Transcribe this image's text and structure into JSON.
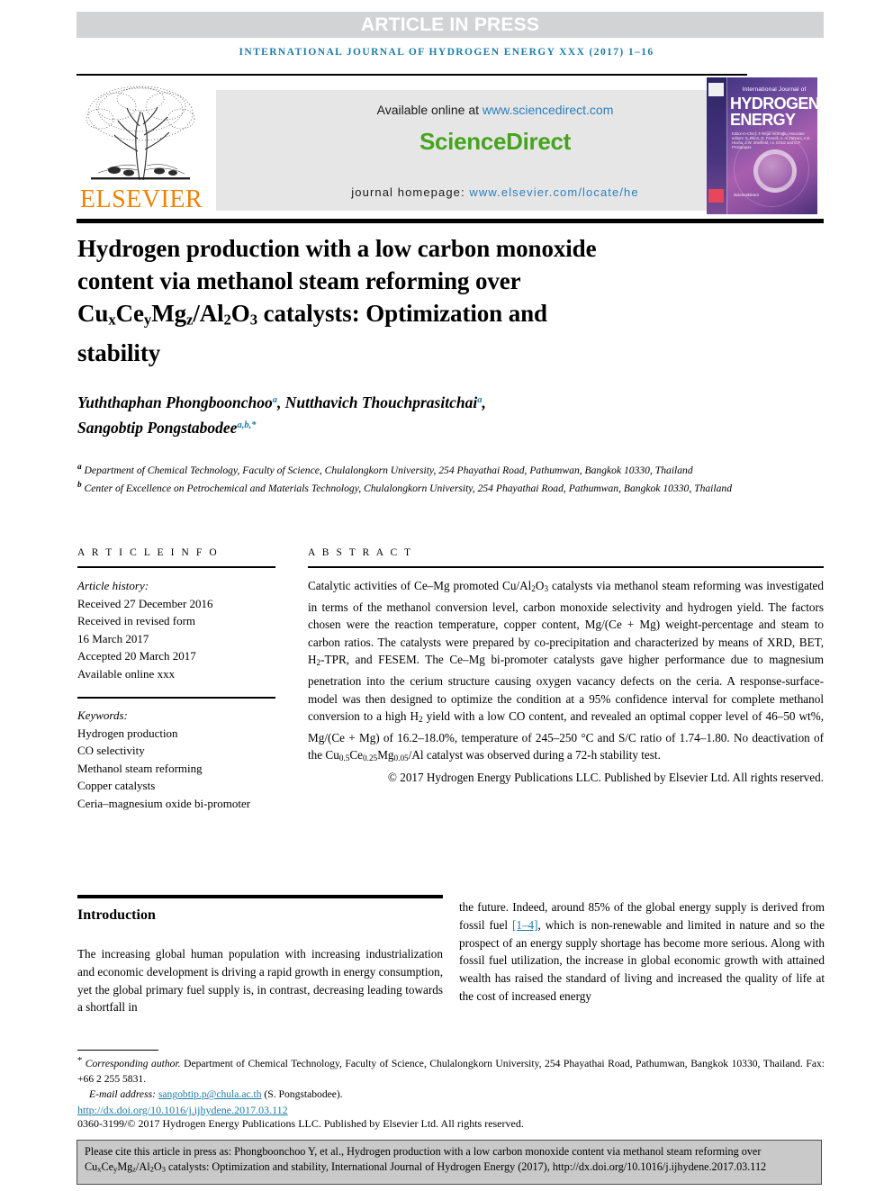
{
  "banner": {
    "article_in_press": "ARTICLE IN PRESS",
    "running_head": "INTERNATIONAL JOURNAL OF HYDROGEN ENERGY XXX (2017) 1–16"
  },
  "masthead": {
    "publisher_name": "ELSEVIER",
    "available_online_prefix": "Available online at ",
    "sciencedirect_url": "www.sciencedirect.com",
    "sciencedirect_logo": "ScienceDirect",
    "journal_homepage_prefix": "journal homepage: ",
    "journal_homepage_url": "www.elsevier.com/locate/he",
    "cover": {
      "line1": "International Journal of",
      "line2": "HYDROGEN",
      "line3": "ENERGY",
      "editors": "Editor-in-Chief: T. Nejat Veziroğlu   Associate editors: S. Dunn, D. Fennell, A. Al Zahrani, A.E. Hoxha, J.W. Sheffield, I.e. Ersoz and E.P. Protopapas",
      "sciencedirect_mark": "ScienceDirect"
    }
  },
  "article": {
    "title_line1": "Hydrogen production with a low carbon monoxide",
    "title_line2": "content via methanol steam reforming over",
    "title_line3_formula": "Cu",
    "title_line3_rest": " catalysts: Optimization and",
    "title_line4": "stability",
    "title_plain": "Hydrogen production with a low carbon monoxide content via methanol steam reforming over CuxCeyMgz/Al2O3 catalysts: Optimization and stability",
    "authors": [
      {
        "name": "Yuththaphan Phongboonchoo",
        "marks": "a"
      },
      {
        "name": "Nutthavich Thouchprasitchai",
        "marks": "a"
      },
      {
        "name": "Sangobtip Pongstabodee",
        "marks": "a,b,*"
      }
    ],
    "affiliations": [
      {
        "mark": "a",
        "text": "Department of Chemical Technology, Faculty of Science, Chulalongkorn University, 254 Phayathai Road, Pathumwan, Bangkok 10330, Thailand"
      },
      {
        "mark": "b",
        "text": "Center of Excellence on Petrochemical and Materials Technology, Chulalongkorn University, 254 Phayathai Road, Pathumwan, Bangkok 10330, Thailand"
      }
    ]
  },
  "article_info": {
    "label": "A R T I C L E   I N F O",
    "history_label": "Article history:",
    "history": [
      "Received 27 December 2016",
      "Received in revised form",
      "16 March 2017",
      "Accepted 20 March 2017",
      "Available online xxx"
    ],
    "keywords_label": "Keywords:",
    "keywords": [
      "Hydrogen production",
      "CO selectivity",
      "Methanol steam reforming",
      "Copper catalysts",
      "Ceria–magnesium oxide bi-promoter"
    ]
  },
  "abstract": {
    "label": "A B S T R A C T",
    "body": "Catalytic activities of Ce–Mg promoted Cu/Al2O3 catalysts via methanol steam reforming was investigated in terms of the methanol conversion level, carbon monoxide selectivity and hydrogen yield. The factors chosen were the reaction temperature, copper content, Mg/(Ce + Mg) weight-percentage and steam to carbon ratios. The catalysts were prepared by co-precipitation and characterized by means of XRD, BET, H2-TPR, and FESEM. The Ce–Mg bi-promoter catalysts gave higher performance due to magnesium penetration into the cerium structure causing oxygen vacancy defects on the ceria. A response-surface-model was then designed to optimize the condition at a 95% confidence interval for complete methanol conversion to a high H2 yield with a low CO content, and revealed an optimal copper level of 46–50 wt%, Mg/(Ce + Mg) of 16.2–18.0%, temperature of 245–250 °C and S/C ratio of 1.74–1.80. No deactivation of the Cu0.5Ce0.25Mg0.05/Al catalyst was observed during a 72-h stability test.",
    "copyright": "© 2017 Hydrogen Energy Publications LLC. Published by Elsevier Ltd. All rights reserved."
  },
  "introduction": {
    "heading": "Introduction",
    "left_column": "The increasing global human population with increasing industrialization and economic development is driving a rapid growth in energy consumption, yet the global primary fuel supply is, in contrast, decreasing leading towards a shortfall in",
    "right_column_before_ref": "the future. Indeed, around 85% of the global energy supply is derived from fossil fuel ",
    "reference_link": "[1–4]",
    "right_column_after_ref": ", which is non-renewable and limited in nature and so the prospect of an energy supply shortage has become more serious. Along with fossil fuel utilization, the increase in global economic growth with attained wealth has raised the standard of living and increased the quality of life at the cost of increased energy"
  },
  "footnotes": {
    "corresponding_label": "Corresponding author.",
    "corresponding_text": " Department of Chemical Technology, Faculty of Science, Chulalongkorn University, 254 Phayathai Road, Pathumwan, Bangkok 10330, Thailand. Fax: +66 2 255 5831.",
    "email_label": "E-mail address: ",
    "email": "sangobtip.p@chula.ac.th",
    "email_owner": " (S. Pongstabodee).",
    "doi": "http://dx.doi.org/10.1016/j.ijhydene.2017.03.112",
    "issn": "0360-3199/© 2017 Hydrogen Energy Publications LLC. Published by Elsevier Ltd. All rights reserved."
  },
  "cite_box": {
    "text_part1": "Please cite this article in press as: Phongboonchoo Y, et al., Hydrogen production with a low carbon monoxide content via methanol steam reforming over Cu",
    "text_part2": " catalysts: Optimization and stability, International Journal of Hydrogen Energy (2017), http://dx.doi.org/10.1016/j.ijhydene.2017.03.112"
  },
  "colors": {
    "banner_gray": "#d2d3d5",
    "link_blue": "#1b7ca8",
    "sciencedirect_green": "#45a41d",
    "elsevier_orange": "#ef8200",
    "cite_box_gray": "#c9c9c9"
  }
}
